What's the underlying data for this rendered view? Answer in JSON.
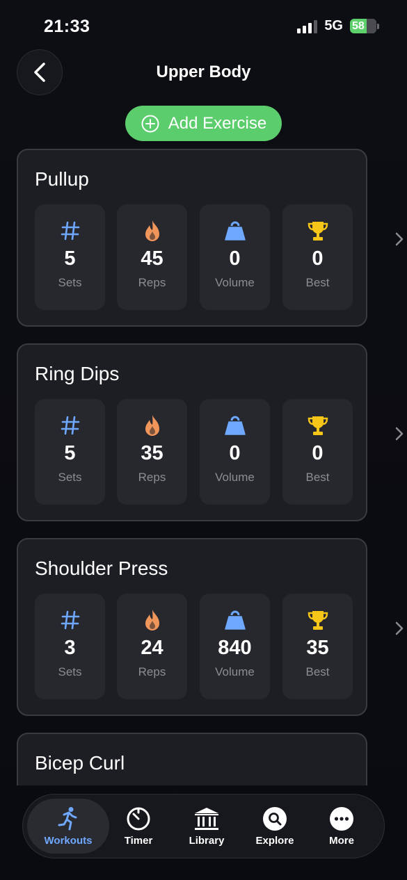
{
  "status": {
    "time": "21:33",
    "network": "5G",
    "battery": "58"
  },
  "header": {
    "title": "Upper Body"
  },
  "add_button": {
    "label": "Add Exercise"
  },
  "exercises": [
    {
      "name": "Pullup",
      "stats": [
        {
          "value": "5",
          "label": "Sets",
          "icon": "hash-icon"
        },
        {
          "value": "45",
          "label": "Reps",
          "icon": "flame-icon"
        },
        {
          "value": "0",
          "label": "Volume",
          "icon": "weight-icon"
        },
        {
          "value": "0",
          "label": "Best",
          "icon": "trophy-icon"
        }
      ]
    },
    {
      "name": "Ring Dips",
      "stats": [
        {
          "value": "5",
          "label": "Sets",
          "icon": "hash-icon"
        },
        {
          "value": "35",
          "label": "Reps",
          "icon": "flame-icon"
        },
        {
          "value": "0",
          "label": "Volume",
          "icon": "weight-icon"
        },
        {
          "value": "0",
          "label": "Best",
          "icon": "trophy-icon"
        }
      ]
    },
    {
      "name": "Shoulder Press",
      "stats": [
        {
          "value": "3",
          "label": "Sets",
          "icon": "hash-icon"
        },
        {
          "value": "24",
          "label": "Reps",
          "icon": "flame-icon"
        },
        {
          "value": "840",
          "label": "Volume",
          "icon": "weight-icon"
        },
        {
          "value": "35",
          "label": "Best",
          "icon": "trophy-icon"
        }
      ]
    },
    {
      "name": "Bicep Curl"
    }
  ],
  "tabs": [
    {
      "label": "Workouts",
      "icon": "running-icon",
      "active": true
    },
    {
      "label": "Timer",
      "icon": "timer-icon"
    },
    {
      "label": "Library",
      "icon": "library-icon"
    },
    {
      "label": "Explore",
      "icon": "search-icon"
    },
    {
      "label": "More",
      "icon": "more-icon"
    }
  ],
  "colors": {
    "accent_green": "#5ccd6c",
    "active_tab": "#6fa8ff",
    "hash": "#6fa8ff",
    "flame": "#f0965a",
    "weight": "#6fa8ff",
    "trophy": "#f5c518"
  }
}
